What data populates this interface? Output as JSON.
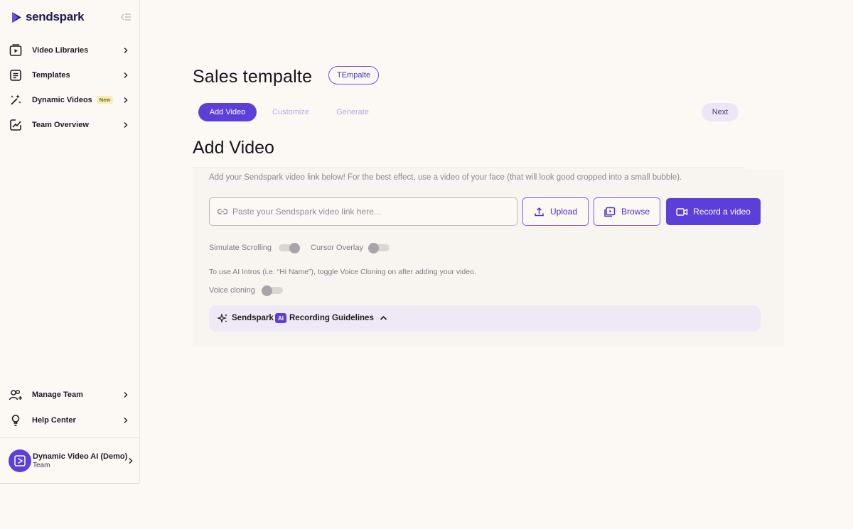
{
  "app": {
    "logo_text": "sendspark"
  },
  "sidebar": {
    "items": [
      {
        "label": "Video Libraries",
        "icon": "video-library-icon"
      },
      {
        "label": "Templates",
        "icon": "template-icon"
      },
      {
        "label": "Dynamic Videos",
        "icon": "magic-wand-icon",
        "badge": "New"
      },
      {
        "label": "Team Overview",
        "icon": "chart-icon"
      }
    ],
    "bottom_items": [
      {
        "label": "Manage Team",
        "icon": "team-icon"
      },
      {
        "label": "Help Center",
        "icon": "lightbulb-icon"
      }
    ],
    "org": {
      "name": "Dynamic Video AI (Demo)",
      "type": "Team"
    }
  },
  "header": {
    "title": "Sales tempalte",
    "tag": "TEmpalte"
  },
  "steps": {
    "tabs": [
      "Add Video",
      "Customize",
      "Generate"
    ],
    "active": "Add Video",
    "next_label": "Next"
  },
  "add_video": {
    "title": "Add Video",
    "hint": "Add your Sendspark video link below! For the best effect, use a video of your face (that will look good cropped into a small bubble).",
    "link_placeholder": "Paste your Sendspark video link here...",
    "upload_label": "Upload",
    "browse_label": "Browse",
    "record_label": "Record a video",
    "simulate_scrolling_label": "Simulate Scrolling",
    "simulate_scrolling_on": false,
    "cursor_overlay_label": "Cursor Overlay",
    "cursor_overlay_on": false,
    "ai_note": "To use AI Intros (i.e. “Hi Name”), toggle Voice Cloning on after adding your video.",
    "voice_cloning_label": "Voice cloning",
    "voice_cloning_on": false,
    "guidelines": {
      "brand": "Sendspark",
      "chip": "AI",
      "text": "Recording Guidelines"
    }
  },
  "colors": {
    "accent": "#5b3fd8",
    "background": "#fcf9f5",
    "guide_bg": "#efe9f6"
  }
}
